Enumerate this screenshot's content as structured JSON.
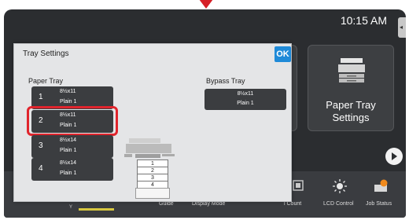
{
  "status": {
    "time": "10:15 AM"
  },
  "tiles": {
    "paper_tray_label_line1": "Paper Tray",
    "paper_tray_label_line2": "Settings"
  },
  "bottom_bar": {
    "items": [
      "Guide",
      "Display Mode",
      "l Count",
      "LCD Control",
      "Job Status"
    ],
    "y_label": "Y"
  },
  "dialog": {
    "title": "Tray Settings",
    "ok_label": "OK",
    "paper_tray_label": "Paper Tray",
    "bypass_tray_label": "Bypass Tray",
    "trays": [
      {
        "num": "1",
        "size": "8½x11",
        "type": "Plain 1"
      },
      {
        "num": "2",
        "size": "8½x11",
        "type": "Plain 1"
      },
      {
        "num": "3",
        "size": "8½x14",
        "type": "Plain 1"
      },
      {
        "num": "4",
        "size": "8½x14",
        "type": "Plain 1"
      }
    ],
    "bypass": {
      "size": "8½x11",
      "type": "Plain 1"
    },
    "stack_labels": [
      "1",
      "2",
      "3",
      "4"
    ]
  },
  "colors": {
    "accent": "#1f8ad8",
    "highlight": "#e0242c",
    "panel": "#2b2d30"
  }
}
